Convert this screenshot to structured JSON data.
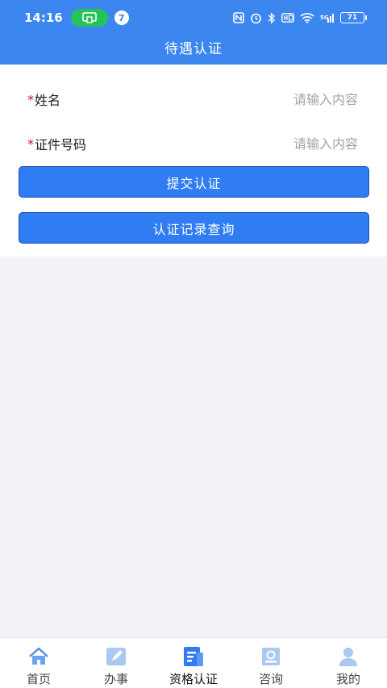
{
  "status_bar": {
    "time": "14:16",
    "notification_count": "7",
    "battery_level": "71"
  },
  "header": {
    "title": "待遇认证"
  },
  "form": {
    "name_label": "姓名",
    "name_placeholder": "请输入内容",
    "id_label": "证件号码",
    "id_placeholder": "请输入内容",
    "required_mark": "*"
  },
  "buttons": {
    "submit": "提交认证",
    "records": "认证记录查询"
  },
  "tabbar": {
    "items": [
      {
        "label": "首页",
        "icon": "home-icon"
      },
      {
        "label": "办事",
        "icon": "pencil-icon"
      },
      {
        "label": "资格认证",
        "icon": "certificate-icon",
        "active": true
      },
      {
        "label": "咨询",
        "icon": "book-icon"
      },
      {
        "label": "我的",
        "icon": "user-icon"
      }
    ]
  },
  "colors": {
    "primary": "#3c86f0",
    "button": "#2f7cf3",
    "required": "#c8102e"
  }
}
